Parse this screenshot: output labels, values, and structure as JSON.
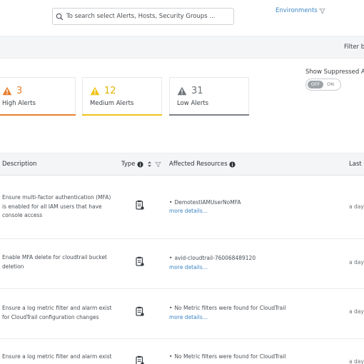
{
  "header": {
    "search_placeholder": "To search select Alerts, Hosts, Security Groups ...",
    "environments_label": "Environments"
  },
  "filter_bar": {
    "label": "Filter b"
  },
  "summary_cards": {
    "high": {
      "count": "3",
      "label": "High Alerts",
      "color": "#e8802f"
    },
    "medium": {
      "count": "12",
      "label": "Medium Alerts",
      "color": "#f0c419"
    },
    "low": {
      "count": "31",
      "label": "Low Alerts",
      "color": "#7c8287"
    }
  },
  "suppressed": {
    "label": "Show Suppressed Ale",
    "toggle_off": "OFF",
    "toggle_on": "ON"
  },
  "table": {
    "columns": {
      "description": "Description",
      "type": "Type",
      "affected_resources": "Affected Resources",
      "last_seen": "Last S"
    },
    "rows": [
      {
        "description": "Ensure multi-factor authentication (MFA) is enabled for all IAM users that have console access",
        "resource": "DemotestIAMUserNoMFA",
        "more": "more details...",
        "last_seen": "a day"
      },
      {
        "description": "Enable MFA delete for cloudtrail bucket deletion",
        "resource": "avid-cloudtrail-760068489120",
        "more": "more details...",
        "last_seen": "a day"
      },
      {
        "description": "Ensure a log metric filter and alarm exist for CloudTrail configuration changes",
        "resource": "No Metric filters were found for CloudTrail",
        "more": "more details...",
        "last_seen": "a day"
      },
      {
        "description": "Ensure a log metric filter and alarm exist",
        "resource": "No Metric filters were found for CloudTrail",
        "more": "",
        "last_seen": "a day"
      }
    ]
  }
}
